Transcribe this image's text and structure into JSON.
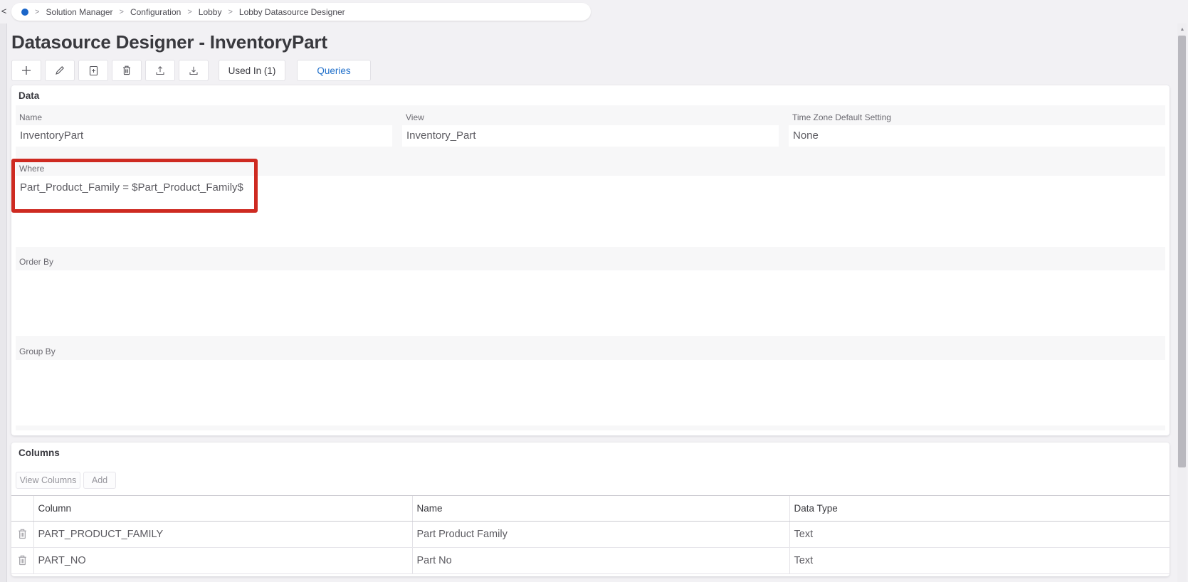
{
  "breadcrumb": {
    "separator": ">",
    "items": [
      "Solution Manager",
      "Configuration",
      "Lobby",
      "Lobby Datasource Designer"
    ]
  },
  "page": {
    "title": "Datasource Designer - InventoryPart"
  },
  "toolbar": {
    "icon_buttons": [
      {
        "name": "add",
        "icon": "plus-icon"
      },
      {
        "name": "edit",
        "icon": "pencil-icon"
      },
      {
        "name": "copy",
        "icon": "copy-document-icon"
      },
      {
        "name": "delete",
        "icon": "trash-icon"
      },
      {
        "name": "upload",
        "icon": "upload-icon"
      },
      {
        "name": "download",
        "icon": "download-icon"
      }
    ],
    "used_in_label": "Used In (1)",
    "queries_label": "Queries"
  },
  "data_section": {
    "title": "Data",
    "fields": {
      "name": {
        "label": "Name",
        "value": "InventoryPart"
      },
      "view": {
        "label": "View",
        "value": "Inventory_Part"
      },
      "time_zone": {
        "label": "Time Zone Default Setting",
        "value": "None"
      }
    },
    "where": {
      "label": "Where",
      "value": "Part_Product_Family = $Part_Product_Family$"
    },
    "order_by": {
      "label": "Order By",
      "value": ""
    },
    "group_by": {
      "label": "Group By",
      "value": ""
    }
  },
  "columns_section": {
    "title": "Columns",
    "view_columns_label": "View Columns",
    "add_label": "Add",
    "table": {
      "headers": [
        "Column",
        "Name",
        "Data Type"
      ],
      "rows": [
        {
          "column": "PART_PRODUCT_FAMILY",
          "name": "Part Product Family",
          "data_type": "Text"
        },
        {
          "column": "PART_NO",
          "name": "Part No",
          "data_type": "Text"
        }
      ]
    }
  },
  "annotation": {
    "highlight_color": "#ce2a21"
  },
  "colors": {
    "accent_blue": "#1f6fca",
    "breadcrumb_dot": "#1b66c9"
  }
}
